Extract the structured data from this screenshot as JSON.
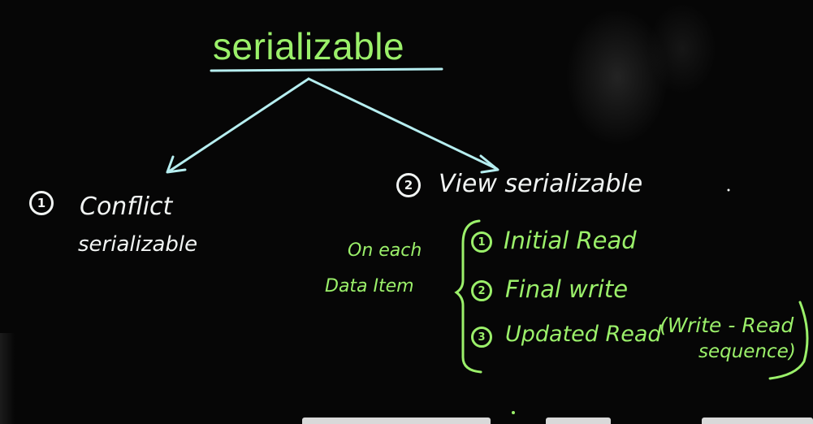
{
  "title": "serializable",
  "branch_1": {
    "number": "1",
    "line1": "Conflict",
    "line2": "serializable"
  },
  "branch_2": {
    "number": "2",
    "text": "View serializable"
  },
  "side_note": {
    "line1": "On each",
    "line2": "Data Item"
  },
  "conditions": [
    {
      "number": "1",
      "text": "Initial Read"
    },
    {
      "number": "2",
      "text": "Final write"
    },
    {
      "number": "3",
      "text": "Updated Read"
    }
  ],
  "parenthetical": {
    "line1": "(Write - Read",
    "line2": "sequence)"
  },
  "colors": {
    "background": "#060606",
    "title_green": "#9bf06a",
    "arrow_cyan": "#b6eef0",
    "chalk_white": "#f1f4f3"
  }
}
